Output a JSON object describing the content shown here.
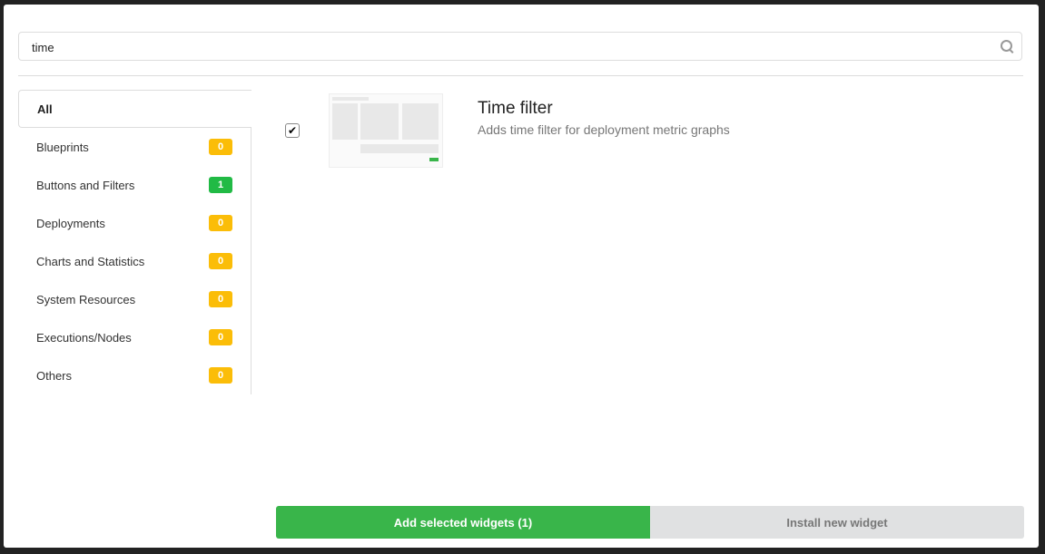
{
  "search": {
    "value": "time",
    "icon": "search-icon"
  },
  "categories": [
    {
      "label": "All",
      "active": true
    },
    {
      "label": "Blueprints",
      "count": "0",
      "color": "#fbbd08"
    },
    {
      "label": "Buttons and Filters",
      "count": "1",
      "color": "#21ba45"
    },
    {
      "label": "Deployments",
      "count": "0",
      "color": "#fbbd08"
    },
    {
      "label": "Charts and Statistics",
      "count": "0",
      "color": "#fbbd08"
    },
    {
      "label": "System Resources",
      "count": "0",
      "color": "#fbbd08"
    },
    {
      "label": "Executions/Nodes",
      "count": "0",
      "color": "#fbbd08"
    },
    {
      "label": "Others",
      "count": "0",
      "color": "#fbbd08"
    }
  ],
  "widget": {
    "title": "Time filter",
    "description": "Adds time filter for deployment metric graphs",
    "checked": true
  },
  "actions": {
    "add": "Add selected widgets (1)",
    "install": "Install new widget"
  }
}
